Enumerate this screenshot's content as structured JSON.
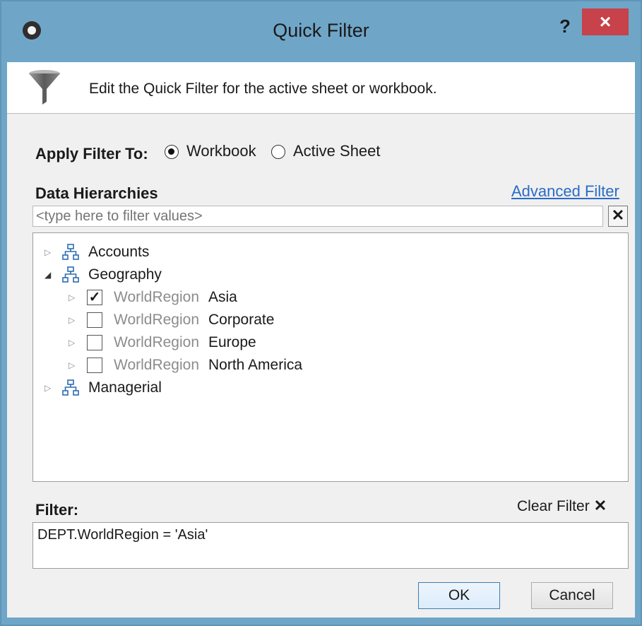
{
  "window": {
    "title": "Quick Filter",
    "help_label": "?",
    "close_label": "×"
  },
  "header": {
    "description": "Edit the Quick Filter for the active sheet or workbook."
  },
  "apply": {
    "label": "Apply Filter To:",
    "options": [
      {
        "label": "Workbook",
        "checked": true
      },
      {
        "label": "Active Sheet",
        "checked": false
      }
    ]
  },
  "hierarchies": {
    "label": "Data Hierarchies",
    "advanced_link": "Advanced Filter",
    "search_placeholder": "<type here to filter values>",
    "clear_label": "✕"
  },
  "tree": {
    "nodes": [
      {
        "label": "Accounts",
        "expanded": false
      },
      {
        "label": "Geography",
        "expanded": true,
        "children": [
          {
            "prefix": "WorldRegion",
            "value": "Asia",
            "checked": true
          },
          {
            "prefix": "WorldRegion",
            "value": "Corporate",
            "checked": false
          },
          {
            "prefix": "WorldRegion",
            "value": "Europe",
            "checked": false
          },
          {
            "prefix": "WorldRegion",
            "value": "North America",
            "checked": false
          }
        ]
      },
      {
        "label": "Managerial",
        "expanded": false
      }
    ]
  },
  "filter": {
    "label": "Filter:",
    "clear_label": "Clear Filter",
    "clear_icon": "✕",
    "expression": "DEPT.WorldRegion = 'Asia'"
  },
  "buttons": {
    "ok": "OK",
    "cancel": "Cancel"
  },
  "colors": {
    "title_bar": "#6fa6c8",
    "close": "#c7424a",
    "link": "#2a6bc6",
    "panel": "#f0f0f0"
  }
}
